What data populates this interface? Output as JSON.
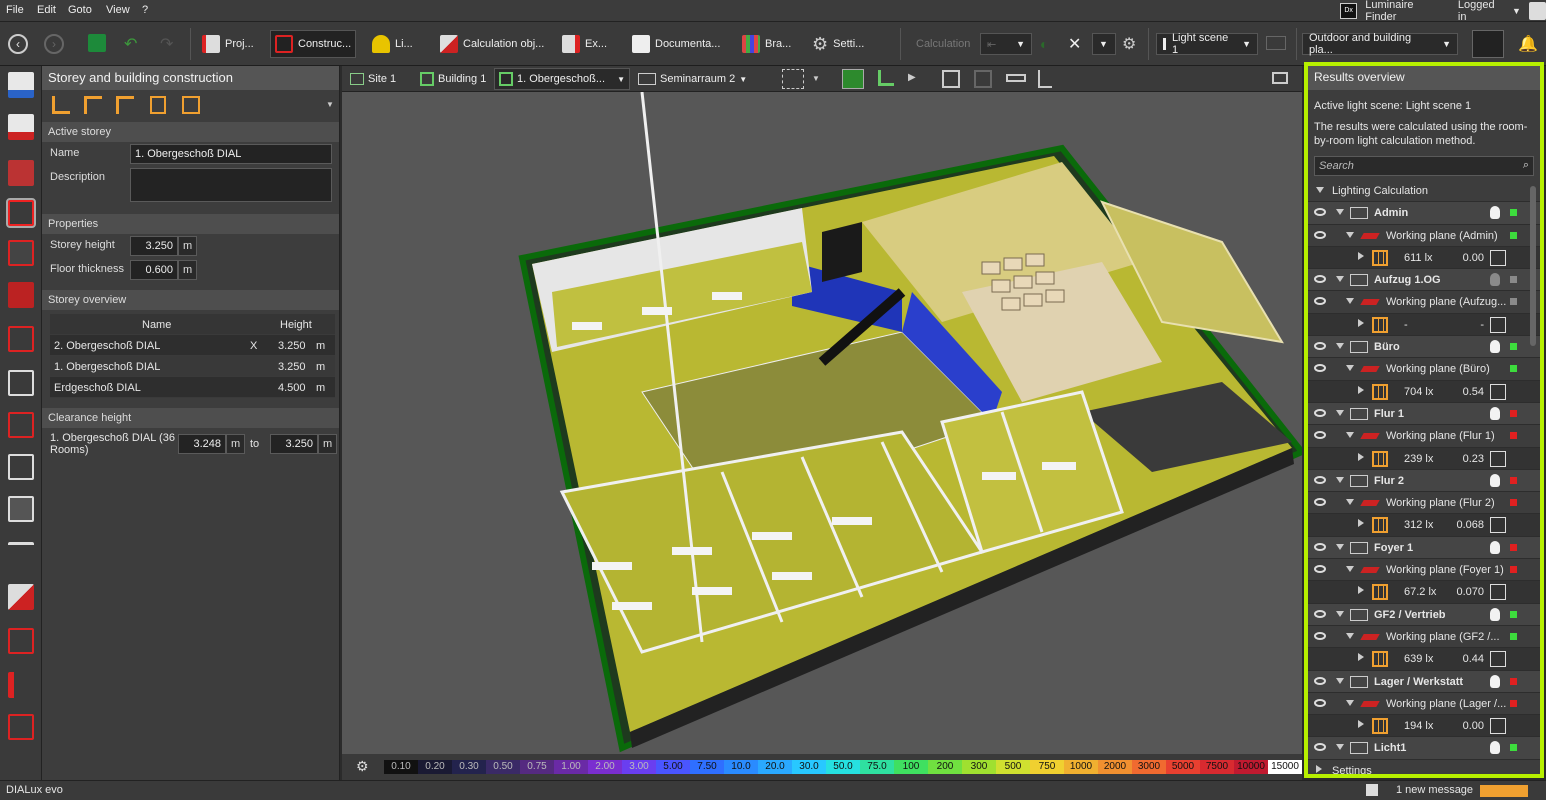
{
  "menu": {
    "file": "File",
    "edit": "Edit",
    "goto": "Goto",
    "view": "View",
    "help": "?",
    "luminaire_finder": "Luminaire Finder",
    "logged_in": "Logged in"
  },
  "toolbar": {
    "items": [
      "Proj...",
      "Construc...",
      "Li...",
      "Calculation obj...",
      "Ex...",
      "Documenta...",
      "Bra...",
      "Setti..."
    ],
    "calculation": "Calculation",
    "light_scene": "Light scene 1",
    "outdoor": "Outdoor and building pla..."
  },
  "left_panel": {
    "title": "Storey and building construction",
    "active_storey": "Active storey",
    "name_label": "Name",
    "name_value": "1. Obergeschoß DIAL",
    "description_label": "Description",
    "properties": "Properties",
    "storey_height_label": "Storey height",
    "storey_height": "3.250",
    "unit_m": "m",
    "floor_thickness_label": "Floor thickness",
    "floor_thickness": "0.600",
    "storey_overview": "Storey overview",
    "col_name": "Name",
    "col_height": "Height",
    "storeys": [
      {
        "name": "2. Obergeschoß DIAL",
        "x": "X",
        "height": "3.250",
        "unit": "m"
      },
      {
        "name": "1. Obergeschoß DIAL",
        "x": "",
        "height": "3.250",
        "unit": "m"
      },
      {
        "name": "Erdgeschoß DIAL",
        "x": "",
        "height": "4.500",
        "unit": "m"
      }
    ],
    "clearance": "Clearance height",
    "clearance_room": "1. Obergeschoß DIAL (36 Rooms)",
    "clearance_from": "3.248",
    "clearance_to_label": "to",
    "clearance_to": "3.250"
  },
  "viewport": {
    "chips": [
      "Site 1",
      "Building 1",
      "1. Obergeschoß...",
      "Seminarraum 2"
    ],
    "legend": [
      "0.10",
      "0.20",
      "0.30",
      "0.50",
      "0.75",
      "1.00",
      "2.00",
      "3.00",
      "5.00",
      "7.50",
      "10.0",
      "20.0",
      "30.0",
      "50.0",
      "75.0",
      "100",
      "200",
      "300",
      "500",
      "750",
      "1000",
      "2000",
      "3000",
      "5000",
      "7500",
      "10000",
      "15000"
    ],
    "legend_colors": [
      "#111111",
      "#1a1a33",
      "#23234d",
      "#3a2a66",
      "#552a80",
      "#6a2aa6",
      "#7a2ed0",
      "#6a3ef0",
      "#4a55ff",
      "#2f6fff",
      "#2a8bff",
      "#2aa9ff",
      "#28c8ff",
      "#26e0e0",
      "#2fe0a0",
      "#3fe060",
      "#70e040",
      "#a0e030",
      "#d0e030",
      "#f0d030",
      "#f0b030",
      "#f09030",
      "#f06a30",
      "#e84030",
      "#d82a30",
      "#c01a30",
      "#ffffff"
    ]
  },
  "results": {
    "title": "Results overview",
    "active_scene": "Active light scene: Light scene 1",
    "method": "The results were calculated using the room-by-room light calculation method.",
    "search_placeholder": "Search",
    "lighting_calc": "Lighting Calculation",
    "rooms": [
      {
        "room": "Admin",
        "plane": "Working plane (Admin)",
        "lux": "611 lx",
        "ratio": "0.00",
        "status": "#3ddc3d",
        "bulb": "#f2f2f2"
      },
      {
        "room": "Aufzug 1.OG",
        "plane": "Working plane (Aufzug...",
        "lux": "-",
        "ratio": "-",
        "status": "#8a8a8a",
        "bulb": "#8a8a8a"
      },
      {
        "room": "Büro",
        "plane": "Working plane (Büro)",
        "lux": "704 lx",
        "ratio": "0.54",
        "status": "#3ddc3d",
        "bulb": "#f2f2f2"
      },
      {
        "room": "Flur 1",
        "plane": "Working plane (Flur 1)",
        "lux": "239 lx",
        "ratio": "0.23",
        "status": "#e02020",
        "bulb": "#f2f2f2"
      },
      {
        "room": "Flur 2",
        "plane": "Working plane (Flur 2)",
        "lux": "312 lx",
        "ratio": "0.068",
        "status": "#e02020",
        "bulb": "#f2f2f2"
      },
      {
        "room": "Foyer 1",
        "plane": "Working plane (Foyer 1)",
        "lux": "67.2 lx",
        "ratio": "0.070",
        "status": "#e02020",
        "bulb": "#f2f2f2"
      },
      {
        "room": "GF2 / Vertrieb",
        "plane": "Working plane (GF2 /...",
        "lux": "639 lx",
        "ratio": "0.44",
        "status": "#3ddc3d",
        "bulb": "#f2f2f2"
      },
      {
        "room": "Lager / Werkstatt",
        "plane": "Working plane (Lager /...",
        "lux": "194 lx",
        "ratio": "0.00",
        "status": "#e02020",
        "bulb": "#f2f2f2"
      }
    ],
    "last_room": "Licht1",
    "settings": "Settings"
  },
  "status": {
    "app": "DIALux evo",
    "message": "1 new message"
  }
}
